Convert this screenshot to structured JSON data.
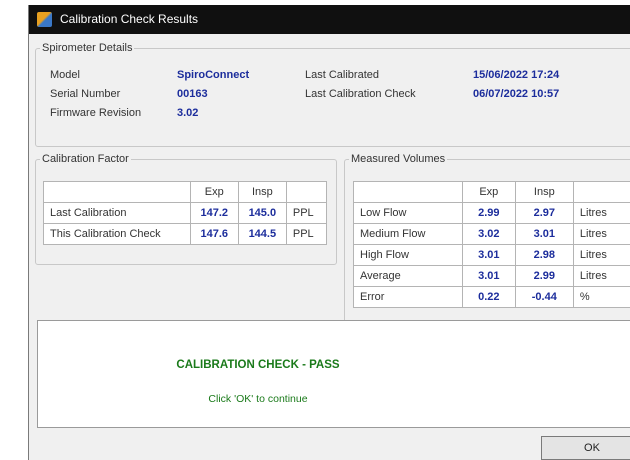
{
  "window": {
    "title": "Calibration Check Results",
    "icon": "app-icon"
  },
  "spirometer_details": {
    "legend": "Spirometer Details",
    "model_label": "Model",
    "model_value": "SpiroConnect",
    "serial_label": "Serial Number",
    "serial_value": "00163",
    "firmware_label": "Firmware Revision",
    "firmware_value": "3.02",
    "last_calibrated_label": "Last Calibrated",
    "last_calibrated_value": "15/06/2022 17:24",
    "last_check_label": "Last Calibration Check",
    "last_check_value": "06/07/2022 10:57"
  },
  "calibration_factor": {
    "legend": "Calibration Factor",
    "headers": [
      "",
      "Exp",
      "Insp",
      ""
    ],
    "rows": [
      {
        "label": "Last Calibration",
        "exp": "147.2",
        "insp": "145.0",
        "unit": "PPL"
      },
      {
        "label": "This Calibration Check",
        "exp": "147.6",
        "insp": "144.5",
        "unit": "PPL"
      }
    ]
  },
  "measured_volumes": {
    "legend": "Measured Volumes",
    "headers": [
      "",
      "Exp",
      "Insp",
      ""
    ],
    "rows": [
      {
        "label": "Low Flow",
        "exp": "2.99",
        "insp": "2.97",
        "unit": "Litres"
      },
      {
        "label": "Medium Flow",
        "exp": "3.02",
        "insp": "3.01",
        "unit": "Litres"
      },
      {
        "label": "High Flow",
        "exp": "3.01",
        "insp": "2.98",
        "unit": "Litres"
      },
      {
        "label": "Average",
        "exp": "3.01",
        "insp": "2.99",
        "unit": "Litres"
      },
      {
        "label": "Error",
        "exp": "0.22",
        "insp": "-0.44",
        "unit": "%"
      }
    ]
  },
  "result": {
    "status": "CALIBRATION CHECK - PASS",
    "hint": "Click 'OK' to continue",
    "status_color": "#1a7a1a"
  },
  "buttons": {
    "ok_label": "OK"
  }
}
